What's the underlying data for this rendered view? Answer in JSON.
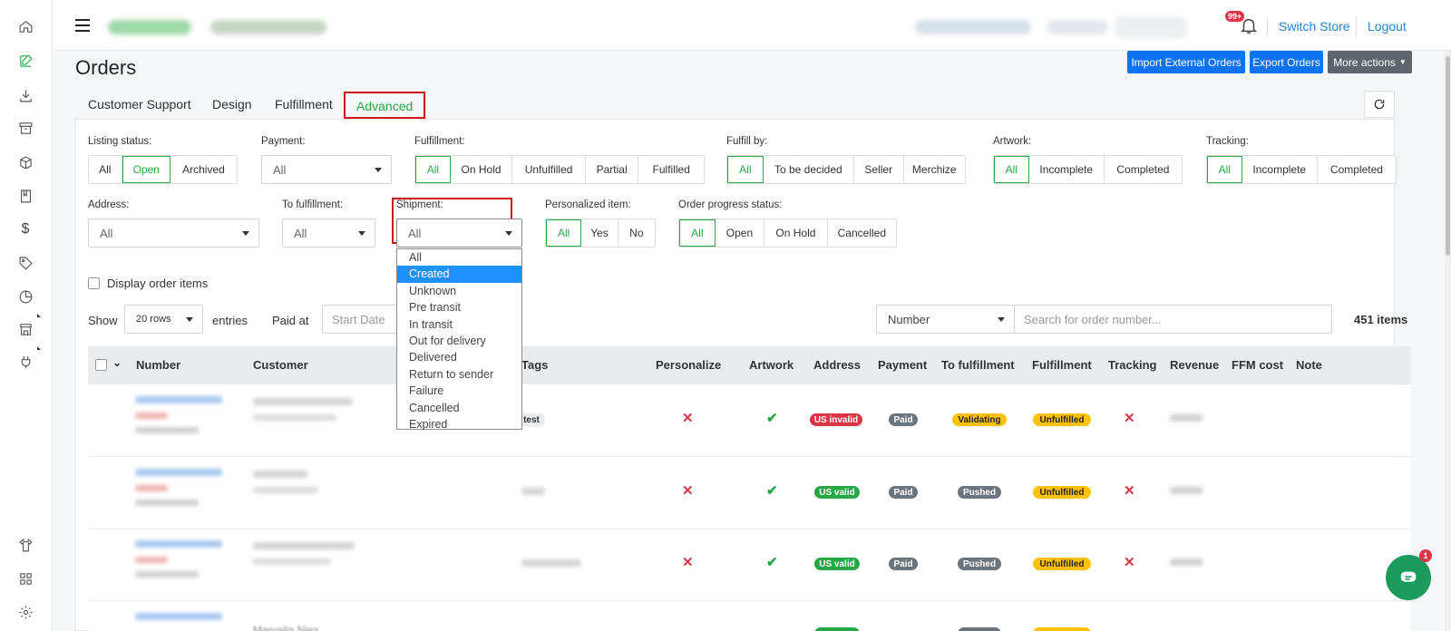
{
  "sidebar": {
    "icons": [
      "home-icon",
      "edit-icon",
      "download-icon",
      "archive-icon",
      "cube-icon",
      "book-icon",
      "dollar-icon",
      "tag-icon",
      "chart-icon",
      "store-icon",
      "plug-icon",
      "shirt-icon",
      "grid-icon",
      "gear-icon"
    ]
  },
  "topbar": {
    "notification_count": "99+",
    "switch_store": "Switch Store",
    "logout": "Logout"
  },
  "page": {
    "title": "Orders",
    "import_btn": "Import External Orders",
    "export_btn": "Export Orders",
    "more_btn": "More actions"
  },
  "tabs": [
    "Customer Support",
    "Design",
    "Fulfillment",
    "Advanced"
  ],
  "active_tab": "Advanced",
  "filters": {
    "listing_status": {
      "label": "Listing status:",
      "options": [
        "All",
        "Open",
        "Archived"
      ],
      "selected": "Open"
    },
    "payment": {
      "label": "Payment:",
      "value": "All"
    },
    "fulfillment": {
      "label": "Fulfillment:",
      "options": [
        "All",
        "On Hold",
        "Unfulfilled",
        "Partial",
        "Fulfilled"
      ],
      "selected": "All"
    },
    "fulfill_by": {
      "label": "Fulfill by:",
      "options": [
        "All",
        "To be decided",
        "Seller",
        "Merchize"
      ],
      "selected": "All"
    },
    "artwork": {
      "label": "Artwork:",
      "options": [
        "All",
        "Incomplete",
        "Completed"
      ],
      "selected": "All"
    },
    "tracking": {
      "label": "Tracking:",
      "options": [
        "All",
        "Incomplete",
        "Completed"
      ],
      "selected": "All"
    },
    "address": {
      "label": "Address:",
      "value": "All"
    },
    "to_fulfillment": {
      "label": "To fulfillment:",
      "value": "All"
    },
    "shipment": {
      "label": "Shipment:",
      "value": "All",
      "options": [
        "All",
        "Created",
        "Unknown",
        "Pre transit",
        "In transit",
        "Out for delivery",
        "Delivered",
        "Return to sender",
        "Failure",
        "Cancelled",
        "Expired"
      ],
      "highlighted": "Created"
    },
    "personalized": {
      "label": "Personalized item:",
      "options": [
        "All",
        "Yes",
        "No"
      ],
      "selected": "All"
    },
    "order_progress": {
      "label": "Order progress status:",
      "options": [
        "All",
        "Open",
        "On Hold",
        "Cancelled"
      ],
      "selected": "All"
    }
  },
  "display_items": "Display order items",
  "show_label": "Show",
  "rows_value": "20 rows",
  "entries_label": "entries",
  "paid_at_label": "Paid at",
  "start_date_placeholder": "Start Date",
  "search_type": "Number",
  "search_placeholder": "Search for order number...",
  "items_count": "451 items",
  "table": {
    "headers": [
      "Number",
      "Customer",
      "Tags",
      "Personalize",
      "Artwork",
      "Address",
      "Payment",
      "To fulfillment",
      "Fulfillment",
      "Tracking",
      "Revenue",
      "FFM cost",
      "Note"
    ],
    "rows": [
      {
        "tag": "test",
        "address": "US invalid",
        "payment": "Paid",
        "to_fulfillment": "Validating",
        "fulfillment": "Unfulfilled"
      },
      {
        "tag": "",
        "address": "US valid",
        "payment": "Paid",
        "to_fulfillment": "Pushed",
        "fulfillment": "Unfulfilled"
      },
      {
        "tag": "",
        "address": "US valid",
        "payment": "Paid",
        "to_fulfillment": "Pushed",
        "fulfillment": "Unfulfilled"
      }
    ],
    "partial_row_customer": "Marvalia Niex"
  },
  "chat_badge": "1",
  "colors": {
    "accent_green": "#28a745",
    "primary_blue": "#0d73f2",
    "highlight_red": "#d0161f"
  }
}
